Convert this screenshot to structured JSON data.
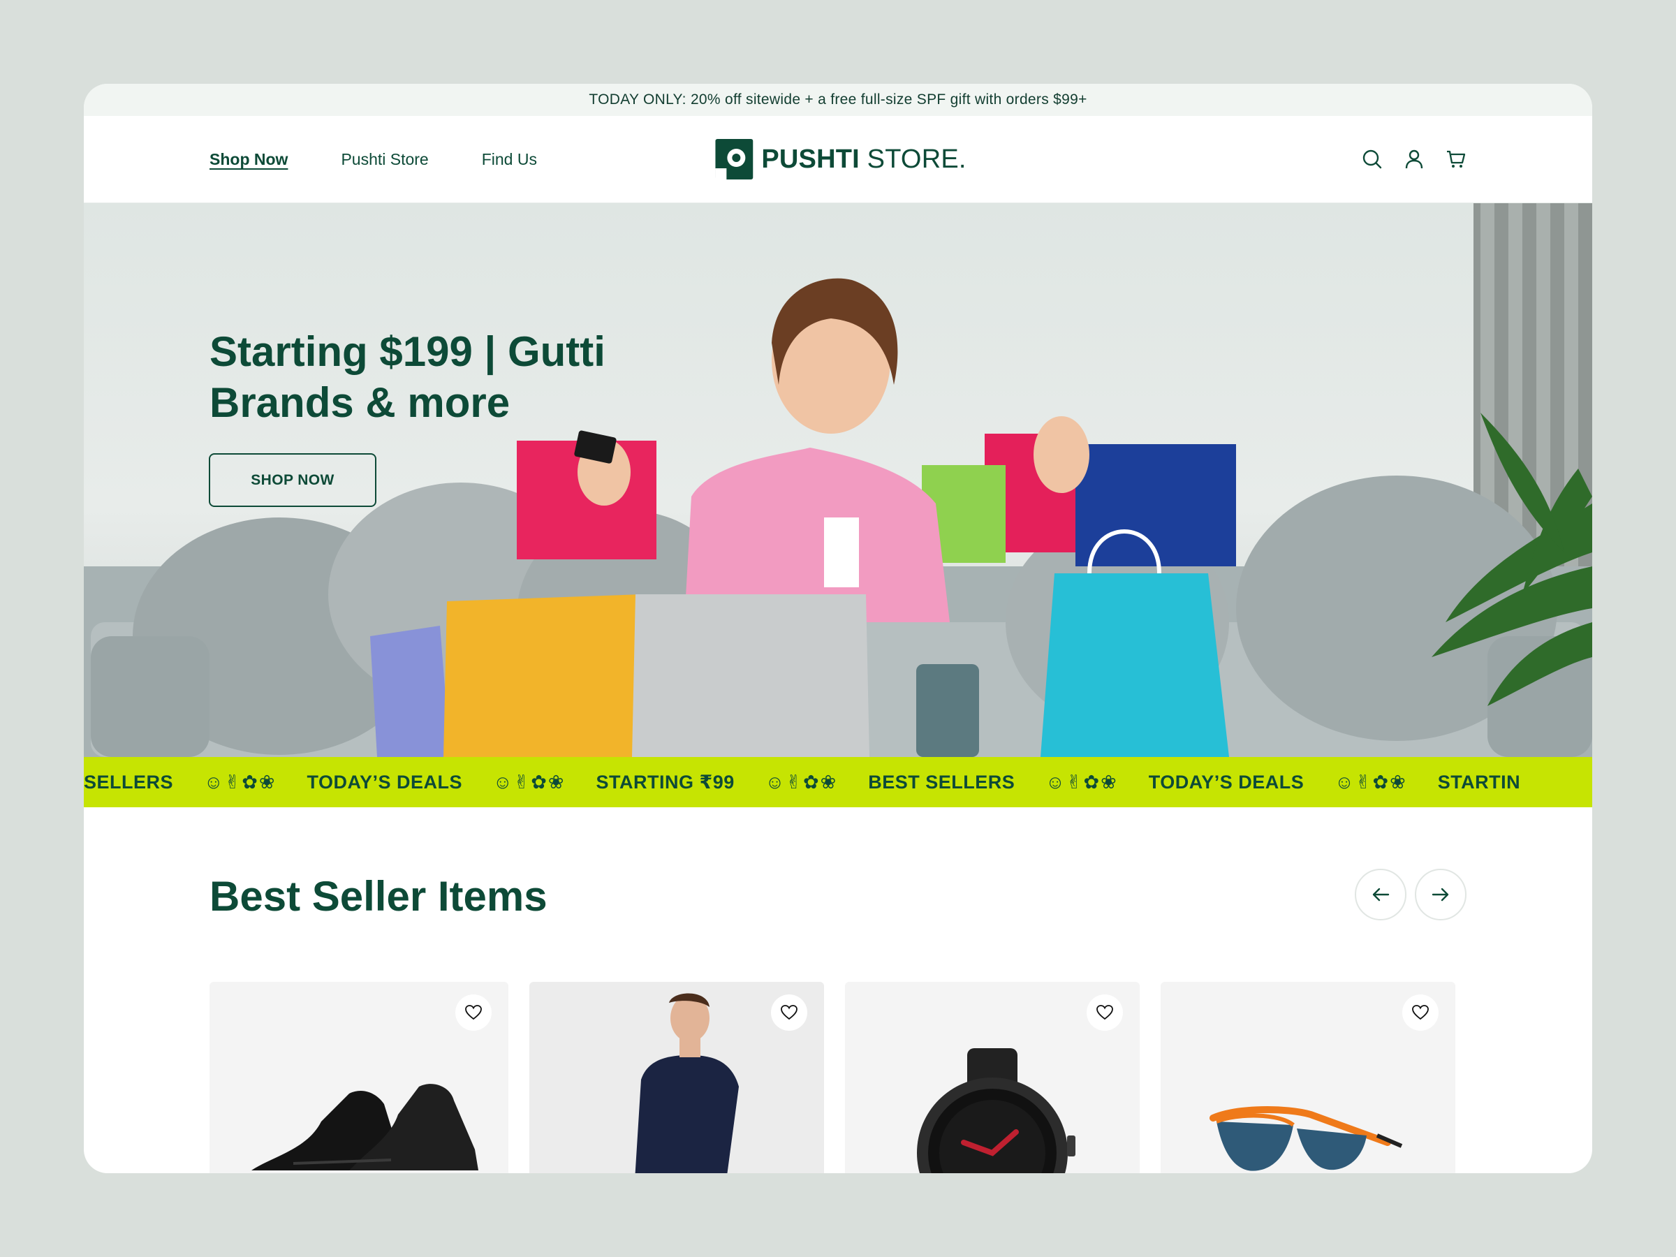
{
  "announcement": "TODAY ONLY: 20% off sitewide + a free full-size SPF gift with orders $99+",
  "nav": {
    "items": [
      {
        "label": "Shop Now",
        "active": true
      },
      {
        "label": "Pushti Store",
        "active": false
      },
      {
        "label": "Find Us",
        "active": false
      }
    ]
  },
  "brand": {
    "bold": "PUSHTI",
    "light": " STORE."
  },
  "header_icons": [
    "search-icon",
    "account-icon",
    "cart-icon"
  ],
  "hero": {
    "title_line1": "Starting $199 | Gutti",
    "title_line2": "Brands & more",
    "button": "SHOP NOW"
  },
  "ticker": {
    "items": [
      "SELLERS",
      "TODAY’S DEALS",
      "STARTING ₹99",
      "BEST SELLERS",
      "TODAY’S DEALS",
      "STARTIN"
    ],
    "icons": "☺✌✿❀"
  },
  "best_sellers": {
    "title": "Best Seller Items",
    "products": [
      {
        "name": "sneakers"
      },
      {
        "name": "sweater"
      },
      {
        "name": "smartwatch"
      },
      {
        "name": "sunglasses"
      }
    ]
  },
  "colors": {
    "brand_green": "#0d4a37",
    "ticker_lime": "#c6e402",
    "page_bg": "#d9dfdb"
  }
}
